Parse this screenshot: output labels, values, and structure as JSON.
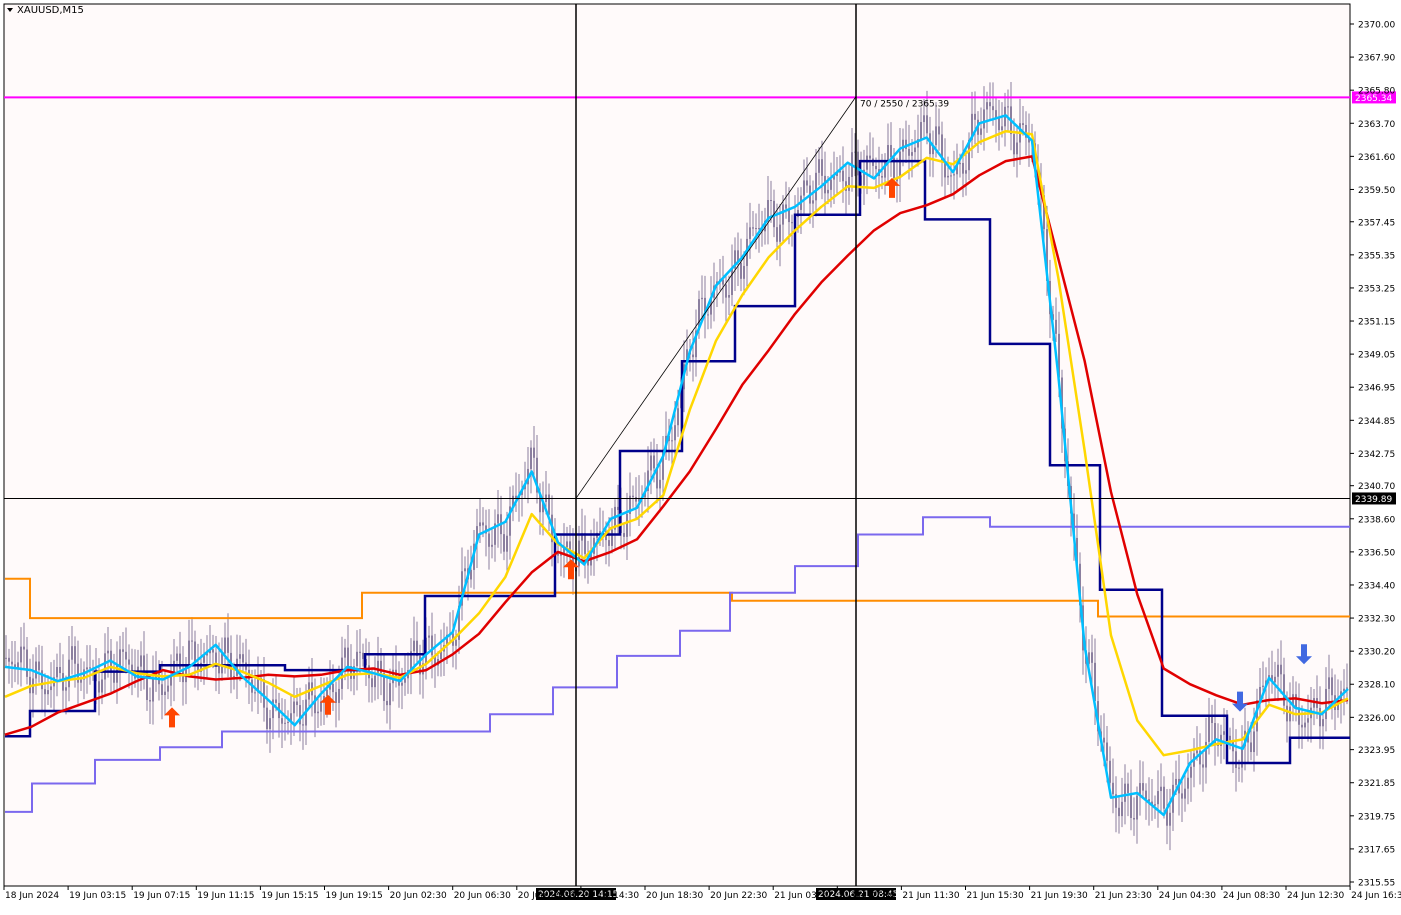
{
  "chart_data": {
    "type": "line",
    "symbol_label": "XAUUSD,M15",
    "x_ticks": [
      "18 Jun 2024",
      "19 Jun 03:15",
      "19 Jun 07:15",
      "19 Jun 11:15",
      "19 Jun 15:15",
      "19 Jun 19:15",
      "20 Jun 02:30",
      "20 Jun 06:30",
      "20 Jun 10:30",
      "20 Jun 14:30",
      "20 Jun 18:30",
      "20 Jun 22:30",
      "21 Jun 03:30",
      "21 Jun 07:30",
      "21 Jun 11:30",
      "21 Jun 15:30",
      "21 Jun 19:30",
      "21 Jun 23:30",
      "24 Jun 04:30",
      "24 Jun 08:30",
      "24 Jun 12:30",
      "24 Jun 16:30"
    ],
    "y_ticks": [
      "2370.00",
      "2367.90",
      "2365.80",
      "2363.70",
      "2361.60",
      "2359.50",
      "2357.45",
      "2355.35",
      "2353.25",
      "2351.15",
      "2349.05",
      "2346.95",
      "2344.85",
      "2342.75",
      "2340.70",
      "2338.60",
      "2336.50",
      "2334.40",
      "2332.30",
      "2330.20",
      "2328.10",
      "2326.00",
      "2323.95",
      "2321.85",
      "2319.75",
      "2317.65",
      "2315.55"
    ],
    "ylim": [
      2315.55,
      2370.0
    ],
    "horizontal_lines": [
      {
        "label": "2365.34",
        "value": 2365.34,
        "color": "#ff00ff"
      },
      {
        "label": "2339.89",
        "value": 2339.89,
        "color": "#000000"
      }
    ],
    "vertical_lines": [
      {
        "label": "2024.06.20 14:15"
      },
      {
        "label": "2024.06.21 08:45"
      }
    ],
    "trendline_label": "70 / 2550 / 2365.39",
    "series": [
      {
        "color": "#00bfff",
        "values": [
          2329.2,
          2329.0,
          2328.3,
          2328.8,
          2329.6,
          2328.6,
          2328.4,
          2329.2,
          2330.6,
          2328.6,
          2327.1,
          2325.5,
          2327.5,
          2329.2,
          2328.8,
          2328.3,
          2330.0,
          2331.4,
          2337.6,
          2338.4,
          2341.6,
          2337.1,
          2335.7,
          2338.6,
          2339.3,
          2342.6,
          2349.2,
          2353.4,
          2355.2,
          2357.7,
          2358.4,
          2359.7,
          2361.2,
          2360.2,
          2362.1,
          2362.8,
          2360.6,
          2363.7,
          2364.2,
          2362.6,
          2347.7,
          2330.5,
          2320.9,
          2321.2,
          2319.8,
          2323.1,
          2324.6,
          2324.0,
          2328.5,
          2326.6,
          2326.2,
          2327.8
        ]
      },
      {
        "color": "#ffd700",
        "values": [
          2327.3,
          2328.0,
          2328.3,
          2328.5,
          2329.2,
          2328.8,
          2328.6,
          2328.7,
          2329.4,
          2328.9,
          2328.2,
          2327.3,
          2328.0,
          2328.7,
          2328.8,
          2328.5,
          2329.4,
          2330.9,
          2332.6,
          2334.9,
          2338.9,
          2337.0,
          2336.1,
          2338.0,
          2338.6,
          2340.1,
          2345.5,
          2349.9,
          2352.8,
          2355.2,
          2356.9,
          2358.4,
          2359.7,
          2359.6,
          2360.3,
          2361.5,
          2361.1,
          2362.5,
          2363.2,
          2363.0,
          2353.9,
          2342.9,
          2331.2,
          2325.8,
          2323.6,
          2323.9,
          2324.3,
          2324.6,
          2326.8,
          2326.2,
          2326.3,
          2327.2
        ]
      },
      {
        "color": "#e00000",
        "values": [
          2324.9,
          2325.4,
          2326.3,
          2326.9,
          2327.5,
          2328.3,
          2329.0,
          2328.6,
          2328.4,
          2328.5,
          2328.7,
          2328.6,
          2328.7,
          2329.0,
          2329.1,
          2328.7,
          2329.0,
          2330.0,
          2331.3,
          2333.3,
          2335.2,
          2336.5,
          2335.9,
          2336.5,
          2337.3,
          2339.4,
          2341.6,
          2344.3,
          2347.1,
          2349.3,
          2351.6,
          2353.6,
          2355.3,
          2356.9,
          2358.0,
          2358.5,
          2359.2,
          2360.4,
          2361.3,
          2361.6,
          2355.1,
          2348.6,
          2340.3,
          2333.8,
          2329.1,
          2328.1,
          2327.4,
          2326.8,
          2327.1,
          2327.2,
          2326.9,
          2327.1
        ]
      }
    ],
    "arrows": [
      {
        "direction": "up",
        "color": "#ff4500"
      },
      {
        "direction": "up",
        "color": "#ff4500"
      },
      {
        "direction": "up",
        "color": "#ff4500"
      },
      {
        "direction": "up",
        "color": "#ff4500"
      },
      {
        "direction": "down",
        "color": "#4169e1"
      },
      {
        "direction": "down",
        "color": "#4169e1"
      }
    ],
    "colors": {
      "background": "#fffafa",
      "candle": "#8b7f9f",
      "navy_step": "#00008b",
      "orange_step": "#ff8c00",
      "violet_step": "#7b68ee"
    }
  }
}
